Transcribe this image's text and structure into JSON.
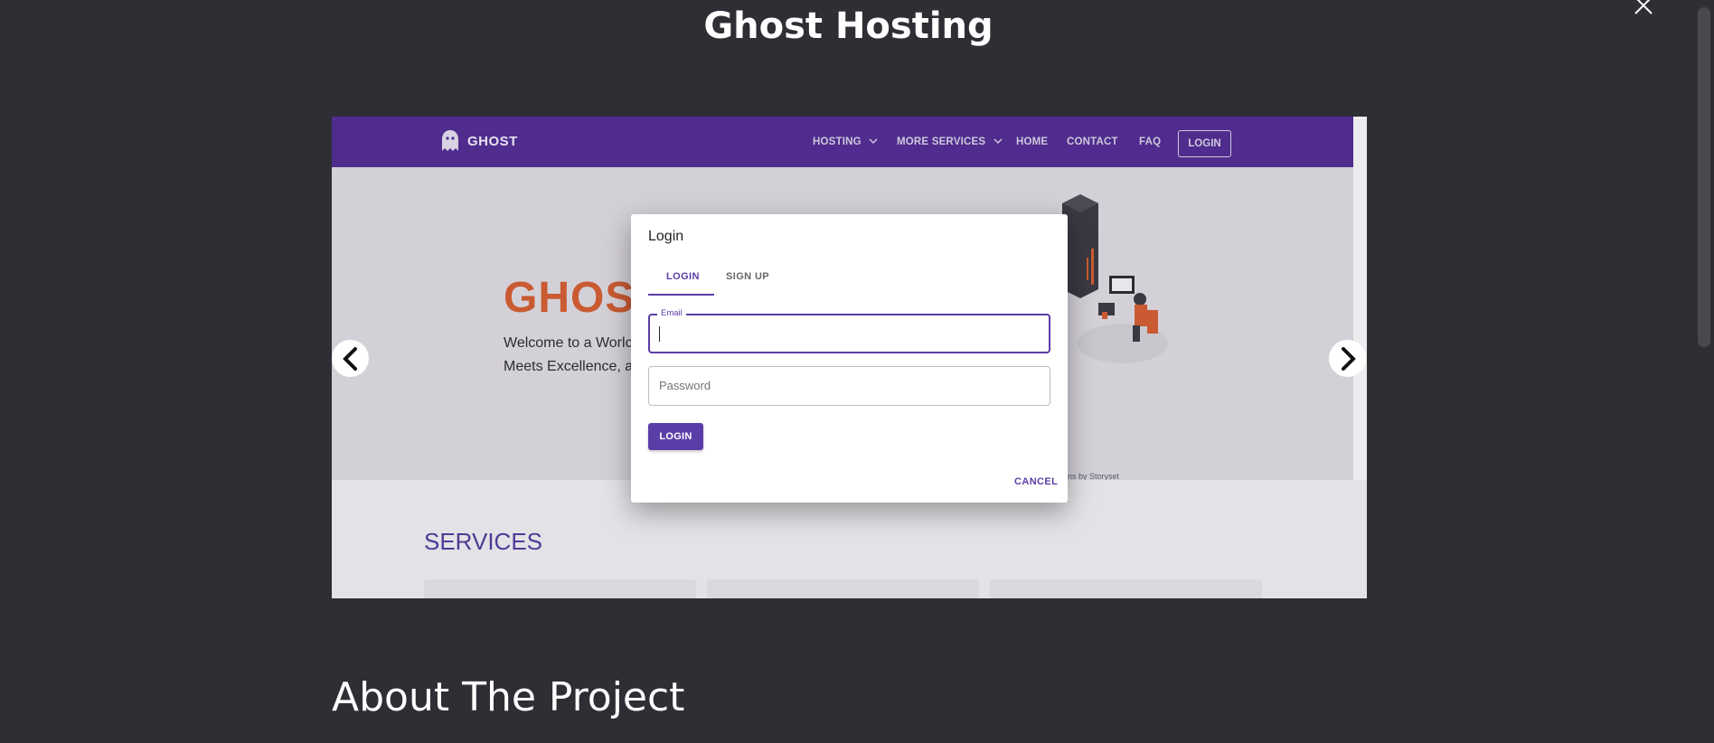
{
  "page": {
    "title": "Ghost Hosting",
    "about_title": "About The Project"
  },
  "site": {
    "logo_text": "GHOST",
    "nav": {
      "hosting": "HOSTING",
      "more_services": "MORE SERVICES",
      "home": "HOME",
      "contact": "CONTACT",
      "faq": "FAQ",
      "login": "LOGIN"
    },
    "hero_title": "GHOS",
    "hero_line1": "Welcome to a Worlc",
    "hero_line2": "Meets Excellence, a",
    "credit": "ons by Storyset",
    "services_title": "SERVICES"
  },
  "modal": {
    "title": "Login",
    "tab_login": "LOGIN",
    "tab_signup": "SIGN UP",
    "email_label": "Email",
    "password_placeholder": "Password",
    "login_button": "LOGIN",
    "cancel_button": "CANCEL"
  },
  "colors": {
    "background": "#2e2e35",
    "nav_purple": "#4f2c8e",
    "accent": "#5b3da8",
    "hero_orange": "#c95a32"
  },
  "icons": [
    "close-icon",
    "ghost-logo-icon",
    "chevron-down-icon",
    "arrow-left-icon",
    "arrow-right-icon"
  ]
}
